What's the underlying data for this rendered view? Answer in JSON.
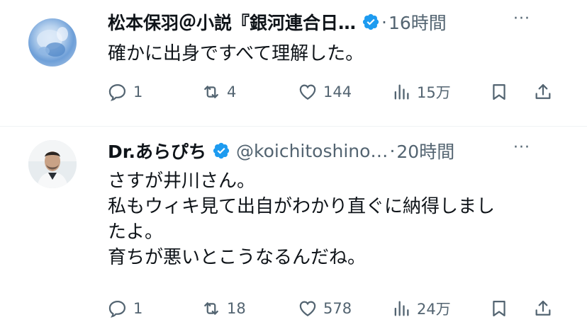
{
  "tweets": [
    {
      "name": "松本保羽＠小説『銀河連合日…",
      "handle": "",
      "time": "16時間",
      "lines": [
        "確かに出身ですべて理解した。"
      ],
      "replies": "1",
      "retweets": "4",
      "likes": "144",
      "views": "15万"
    },
    {
      "name": "Dr.あらぴち",
      "handle": "@koichitoshino…",
      "time": "20時間",
      "lines": [
        "さすが井川さん。",
        "私もウィキ見て出自がわかり直ぐに納得しまし",
        "たよ。",
        "育ちが悪いとこうなるんだね。"
      ],
      "replies": "1",
      "retweets": "18",
      "likes": "578",
      "views": "24万"
    }
  ],
  "more_glyph": "···",
  "dot_separator": "·",
  "colors": {
    "text": "#0f1419",
    "muted": "#536471",
    "verified": "#1d9bf0"
  }
}
